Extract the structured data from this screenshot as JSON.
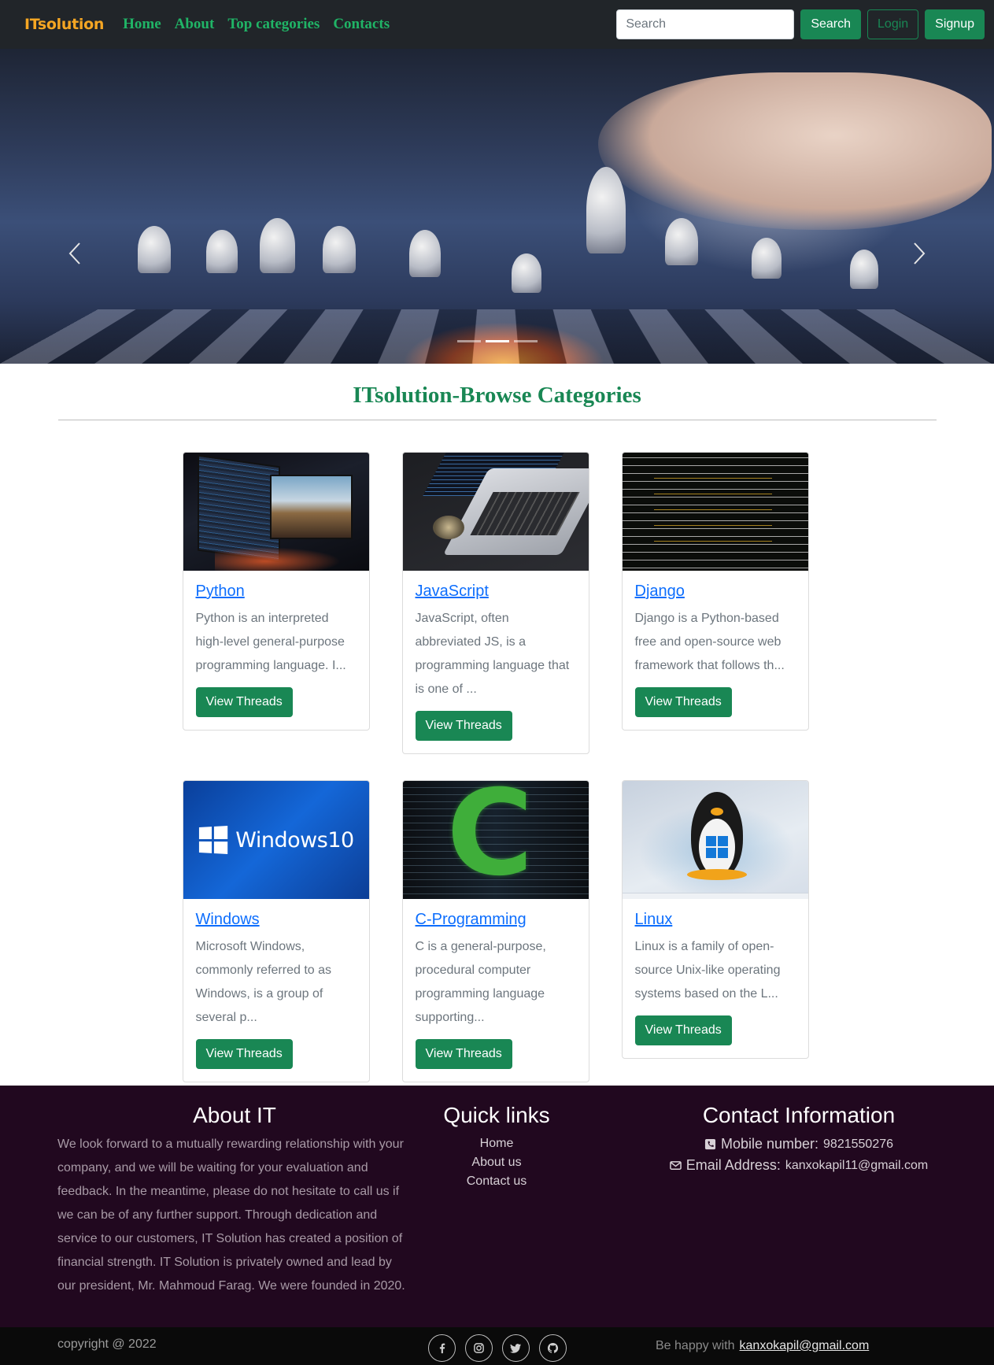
{
  "navbar": {
    "brand": "ITsolution",
    "links": [
      "Home",
      "About",
      "Top categories",
      "Contacts"
    ],
    "search_placeholder": "Search",
    "search_button": "Search",
    "login_button": "Login",
    "signup_button": "Signup"
  },
  "carousel": {
    "active_index": 1,
    "slide_count": 3
  },
  "section": {
    "title": "ITsolution-Browse Categories"
  },
  "categories": [
    {
      "title": "Python",
      "description": "Python is an interpreted high-level general-purpose programming language. I...",
      "button": "View Threads"
    },
    {
      "title": "JavaScript",
      "description": "JavaScript, often abbreviated JS, is a programming language that is one of ...",
      "button": "View Threads"
    },
    {
      "title": "Django",
      "description": "Django is a Python-based free and open-source web framework that follows th...",
      "button": "View Threads"
    },
    {
      "title": "Windows",
      "description": "Microsoft Windows, commonly referred to as Windows, is a group of several p...",
      "button": "View Threads",
      "image_text": "Windows10"
    },
    {
      "title": "C-Programming",
      "description": "C is a general-purpose, procedural computer programming language supporting...",
      "button": "View Threads",
      "image_text": "C"
    },
    {
      "title": "Linux",
      "description": "Linux is a family of open-source Unix-like operating systems based on the L...",
      "button": "View Threads"
    }
  ],
  "footer": {
    "about_heading": "About IT",
    "about_text": "We look forward to a mutually rewarding relationship with your company, and we will be waiting for your evaluation and feedback. In the meantime, please do not hesitate to call us if we can be of any further support. Through dedication and service to our customers, IT Solution has created a position of financial strength. IT Solution is privately owned and lead by our president, Mr. Mahmoud Farag. We were founded in 2020.",
    "links_heading": "Quick links",
    "links": [
      "Home",
      "About us",
      "Contact us"
    ],
    "contact_heading": "Contact Information",
    "mobile_label": "Mobile number:",
    "mobile_value": "9821550276",
    "email_label": "Email Address:",
    "email_value": "kanxokapil11@gmail.com"
  },
  "bottombar": {
    "copyright": "copyright @ 2022",
    "happy_text": "Be happy with",
    "happy_email": "kanxokapil@gmail.com",
    "social_icons": [
      "facebook-icon",
      "instagram-icon",
      "twitter-icon",
      "github-icon"
    ]
  },
  "colors": {
    "navbar_bg": "#212529",
    "brand": "#f5a623",
    "nav_link": "#20b466",
    "success": "#198754",
    "link": "#0d6efd",
    "footer_bg": "#21081f",
    "bottombar_bg": "#0a0a0a"
  }
}
